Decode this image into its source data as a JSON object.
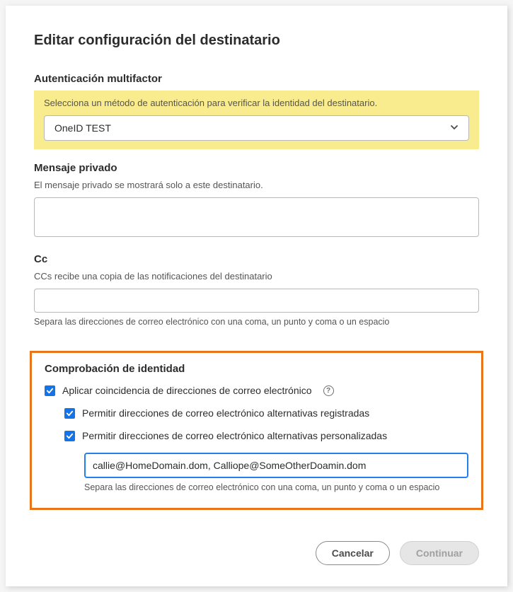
{
  "dialog": {
    "title": "Editar configuración del destinatario"
  },
  "mfa": {
    "label": "Autenticación multifactor",
    "help": "Selecciona un método de autenticación para verificar la identidad del destinatario.",
    "selected": "OneID TEST"
  },
  "privateMessage": {
    "label": "Mensaje privado",
    "help": "El mensaje privado se mostrará solo a este destinatario.",
    "value": ""
  },
  "cc": {
    "label": "Cc",
    "help": "CCs recibe una copia de las notificaciones del destinatario",
    "value": "",
    "footnote": "Separa las direcciones de correo electrónico con una coma, un punto y coma o un espacio"
  },
  "identity": {
    "label": "Comprobación de identidad",
    "enforce": {
      "checked": true,
      "label": "Aplicar coincidencia de direcciones de correo electrónico"
    },
    "allowRegistered": {
      "checked": true,
      "label": "Permitir direcciones de correo electrónico alternativas registradas"
    },
    "allowCustom": {
      "checked": true,
      "label": "Permitir direcciones de correo electrónico alternativas personalizadas"
    },
    "emailsValue": "callie@HomeDomain.dom, Calliope@SomeOtherDoamin.dom",
    "footnote": "Separa las direcciones de correo electrónico con una coma, un punto y coma o un espacio"
  },
  "footer": {
    "cancel": "Cancelar",
    "continue": "Continuar"
  }
}
